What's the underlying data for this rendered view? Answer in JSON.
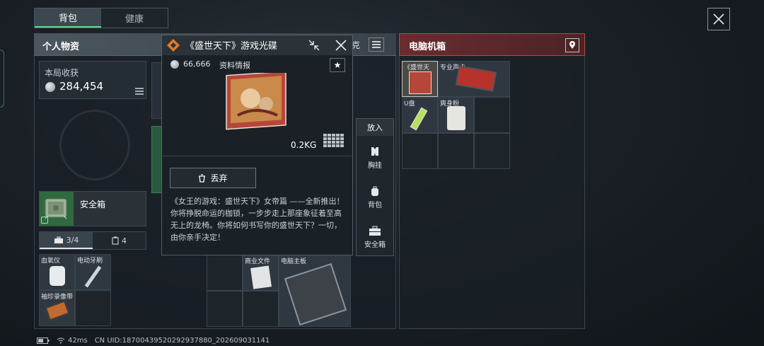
{
  "tabs": [
    {
      "label": "背包",
      "active": true
    },
    {
      "label": "健康",
      "active": false
    }
  ],
  "personal": {
    "title": "个人物资",
    "income_label": "本局收获",
    "income_value": "284,454",
    "safe_label": "安全箱",
    "slot_tabs": [
      {
        "label": "3/4",
        "icon": "toolbox-icon"
      },
      {
        "label": "4",
        "icon": "clipboard-icon"
      }
    ],
    "safe_items": [
      "血氧仪",
      "电动牙刷",
      "袖珍录像带"
    ],
    "lower_items": [
      "商业文件",
      "电脑主板"
    ],
    "hidden_label": "克"
  },
  "popup": {
    "title": "《盛世天下》游戏光碟",
    "price": "66,666",
    "info_label": "资料情报",
    "weight": "0.2KG",
    "drop_label": "丢弃",
    "description": "《女王的游戏：盛世天下》女帝篇 ——全新推出！你将挣脱命运的枷锁，一步步走上那座象征着至高无上的龙椅。你将如何书写你的盛世天下？一切，由你亲手决定！"
  },
  "place_menu": {
    "header": "放入",
    "items": [
      {
        "label": "胸挂",
        "icon": "vest-icon"
      },
      {
        "label": "背包",
        "icon": "backpack-icon"
      },
      {
        "label": "安全箱",
        "icon": "safebox-icon"
      }
    ]
  },
  "computer": {
    "title": "电脑机箱",
    "items": [
      "《盛世天",
      "专业声卡",
      "U盘",
      "爽身粉"
    ]
  },
  "status": {
    "ping": "42ms",
    "uid": "CN UID:18700439520292937880_202609031141"
  },
  "colors": {
    "accent_green": "#5fe08a",
    "pc_header_red": "#6a2c2f"
  }
}
